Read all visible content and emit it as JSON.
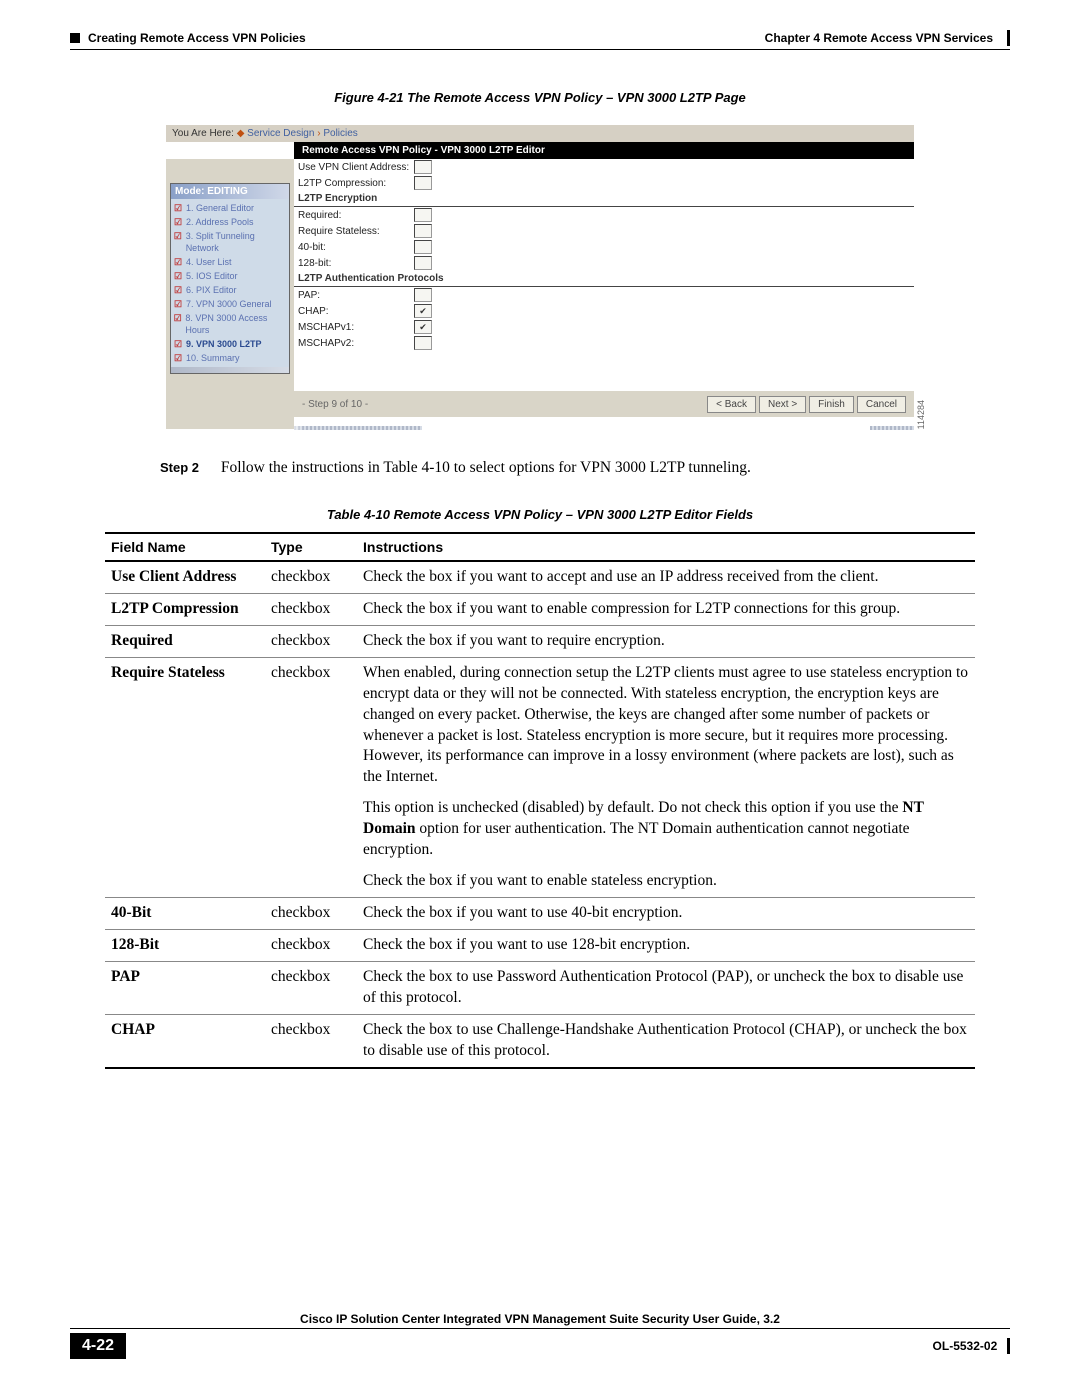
{
  "header": {
    "right": "Chapter 4      Remote Access VPN Services",
    "left": "Creating Remote Access VPN Policies"
  },
  "figure": {
    "caption": "Figure 4-21   The Remote Access VPN Policy – VPN 3000 L2TP Page"
  },
  "screenshot": {
    "youAreHere": "You Are Here:",
    "bc1": "Service Design",
    "bc2": "Policies",
    "title": "Remote Access VPN Policy - VPN 3000 L2TP Editor",
    "modeHead": "Mode: EDITING",
    "nav": [
      "1. General Editor",
      "2. Address Pools",
      "3. Split Tunneling Network",
      "4. User List",
      "5. IOS Editor",
      "6. PIX Editor",
      "7. VPN 3000 General",
      "8. VPN 3000 Access Hours",
      "9. VPN 3000 L2TP",
      "10. Summary"
    ],
    "rows": {
      "r0": "Use VPN Client Address:",
      "r1": "L2TP Compression:",
      "s1": "L2TP Encryption",
      "r2": "Required:",
      "r3": "Require Stateless:",
      "r4": "40-bit:",
      "r5": "128-bit:",
      "s2": "L2TP Authentication Protocols",
      "r6": "PAP:",
      "r7": "CHAP:",
      "r8": "MSCHAPv1:",
      "r9": "MSCHAPv2:"
    },
    "stepOf": "- Step 9 of 10 -",
    "btns": {
      "back": "< Back",
      "next": "Next >",
      "finish": "Finish",
      "cancel": "Cancel"
    },
    "imgId": "114284"
  },
  "step": {
    "label": "Step 2",
    "text1": "Follow the instructions in ",
    "link": "Table 4-10",
    "text2": " to select options for VPN 3000 L2TP tunneling."
  },
  "table": {
    "caption": "Table 4-10   Remote Access VPN Policy – VPN 3000 L2TP Editor Fields",
    "headers": {
      "c1": "Field Name",
      "c2": "Type",
      "c3": "Instructions"
    },
    "rows": [
      {
        "name": "Use Client Address",
        "type": "checkbox",
        "instr": "Check the box if you want to accept and use an IP address received from the client."
      },
      {
        "name": "L2TP Compression",
        "type": "checkbox",
        "instr": "Check the box if you want to enable compression for L2TP connections for this group."
      },
      {
        "name": "Required",
        "type": "checkbox",
        "instr": "Check the box if you want to require encryption."
      },
      {
        "name": "Require Stateless",
        "type": "checkbox",
        "instr": "When enabled, during connection setup the L2TP clients must agree to use stateless encryption to encrypt data or they will not be connected. With stateless encryption, the encryption keys are changed on every packet. Otherwise, the keys are changed after some number of packets or whenever a packet is lost. Stateless encryption is more secure, but it requires more processing. However, its performance can improve in a lossy environment (where packets are lost), such as the Internet.",
        "instr2a": "This option is unchecked (disabled) by default. Do not check this option if you use the ",
        "instr2b": "NT Domain",
        "instr2c": " option for user authentication. The NT Domain authentication cannot negotiate encryption.",
        "instr3": "Check the box if you want to enable stateless encryption."
      },
      {
        "name": "40-Bit",
        "type": "checkbox",
        "instr": "Check the box if you want to use 40-bit encryption."
      },
      {
        "name": "128-Bit",
        "type": "checkbox",
        "instr": "Check the box if you want to use 128-bit encryption."
      },
      {
        "name": "PAP",
        "type": "checkbox",
        "instr": "Check the box to use Password Authentication Protocol (PAP), or uncheck the box to disable use of this protocol."
      },
      {
        "name": "CHAP",
        "type": "checkbox",
        "instr": "Check the box to use Challenge-Handshake Authentication Protocol (CHAP), or uncheck the box to disable use of this protocol."
      }
    ]
  },
  "footer": {
    "title": "Cisco IP Solution Center Integrated VPN Management Suite Security User Guide, 3.2",
    "pageNum": "4-22",
    "docId": "OL-5532-02"
  }
}
